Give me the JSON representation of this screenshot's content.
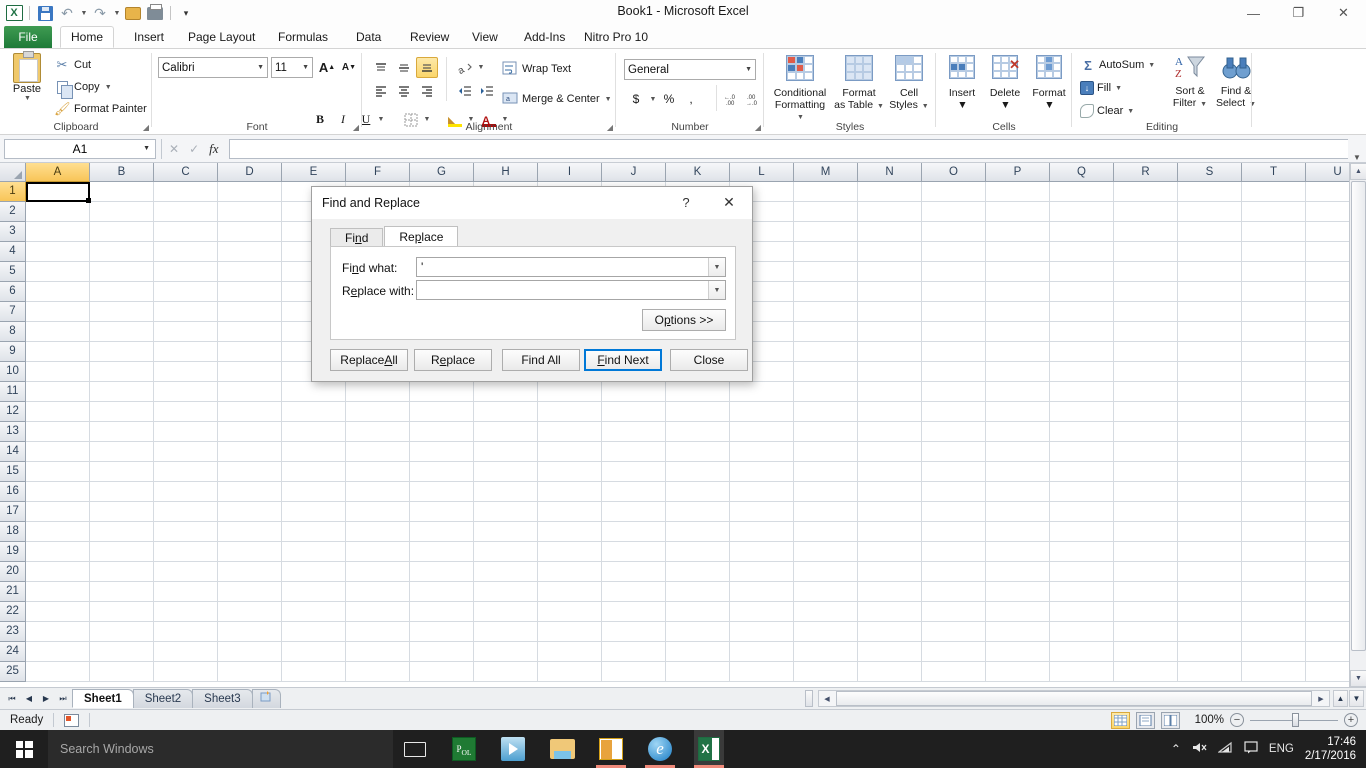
{
  "window": {
    "title": "Book1  -  Microsoft Excel",
    "quick_access": [
      "excel-logo",
      "save",
      "undo",
      "redo",
      "open",
      "print",
      "customize"
    ],
    "controls": {
      "minimize": "—",
      "restore": "❐",
      "close": "✕"
    }
  },
  "ribbon": {
    "tabs": [
      "File",
      "Home",
      "Insert",
      "Page Layout",
      "Formulas",
      "Data",
      "Review",
      "View",
      "Add-Ins",
      "Nitro Pro 10"
    ],
    "active_tab": "Home",
    "right_controls": {
      "collapse": "⌃",
      "help": "?",
      "minimize": "▁",
      "restore": "❐",
      "close": "✖"
    },
    "groups": {
      "clipboard": {
        "title": "Clipboard",
        "paste": "Paste",
        "cut": "Cut",
        "copy": "Copy",
        "format_painter": "Format Painter"
      },
      "font": {
        "title": "Font",
        "font_name": "Calibri",
        "font_size": "11",
        "grow": "A",
        "shrink": "A",
        "bold": "B",
        "italic": "I",
        "underline": "U",
        "borders": "borders",
        "fill_color": "fill-color",
        "font_color": "font-color"
      },
      "alignment": {
        "title": "Alignment",
        "wrap_text": "Wrap Text",
        "merge_center": "Merge & Center",
        "top_align": "Top Align",
        "middle_align": "Middle Align",
        "bottom_align": "Bottom Align",
        "align_left": "Align Text Left",
        "center": "Center",
        "align_right": "Align Text Right",
        "decrease_indent": "Decrease Indent",
        "increase_indent": "Increase Indent",
        "orientation": "Orientation",
        "selected": "Bottom Align"
      },
      "number": {
        "title": "Number",
        "format": "General",
        "accounting": "$",
        "percent": "%",
        "comma": ",",
        "increase_decimal": ".00",
        "decrease_decimal": ".00"
      },
      "styles": {
        "title": "Styles",
        "conditional_formatting": "Conditional\nFormatting",
        "conditional_formatting_l1": "Conditional",
        "conditional_formatting_l2": "Formatting",
        "format_as_table_l1": "Format",
        "format_as_table_l2": "as Table",
        "cell_styles_l1": "Cell",
        "cell_styles_l2": "Styles"
      },
      "cells": {
        "title": "Cells",
        "insert": "Insert",
        "delete": "Delete",
        "format": "Format"
      },
      "editing": {
        "title": "Editing",
        "autosum": "AutoSum",
        "fill": "Fill",
        "clear": "Clear",
        "sort_filter_l1": "Sort &",
        "sort_filter_l2": "Filter",
        "find_select_l1": "Find &",
        "find_select_l2": "Select"
      }
    }
  },
  "formula_bar": {
    "name_box": "A1",
    "formula": "",
    "fx_label": "fx",
    "cancel": "✕",
    "enter": "✓"
  },
  "grid": {
    "columns": [
      "A",
      "B",
      "C",
      "D",
      "E",
      "F",
      "G",
      "H",
      "I",
      "J",
      "K",
      "L",
      "M",
      "N",
      "O",
      "P",
      "Q",
      "R",
      "S",
      "T",
      "U"
    ],
    "rows": [
      1,
      2,
      3,
      4,
      5,
      6,
      7,
      8,
      9,
      10,
      11,
      12,
      13,
      14,
      15,
      16,
      17,
      18,
      19,
      20,
      21,
      22,
      23,
      24,
      25
    ],
    "selected_cell": "A1",
    "selected_column": "A",
    "selected_row": 1,
    "cell_values": []
  },
  "sheet_tabs": {
    "sheets": [
      "Sheet1",
      "Sheet2",
      "Sheet3"
    ],
    "active": "Sheet1",
    "new_sheet_label": "",
    "nav": {
      "first": "⏮",
      "prev": "◀",
      "next": "▶",
      "last": "⏭"
    }
  },
  "status_bar": {
    "mode": "Ready",
    "macro_record": "record-macro",
    "views": [
      "Normal",
      "Page Layout",
      "Page Break Preview"
    ],
    "active_view": "Normal",
    "zoom": "100%",
    "zoom_out": "−",
    "zoom_in": "+"
  },
  "dialog": {
    "title": "Find and Replace",
    "help_btn": "?",
    "close_btn": "✕",
    "tabs": [
      "Find",
      "Replace"
    ],
    "active_tab": "Replace",
    "fields": [
      {
        "label": "Find what:",
        "label_pre": "Fi",
        "label_acc": "n",
        "label_post": "d what:",
        "value": "'"
      },
      {
        "label": "Replace with:",
        "label_pre": "R",
        "label_acc": "e",
        "label_post": "place with:",
        "value": ""
      }
    ],
    "options_button": "Options >>",
    "options_pre": "O",
    "options_acc": "p",
    "options_post": "tions >>",
    "buttons": [
      {
        "label": "Replace All",
        "pre": "Replace ",
        "acc": "A",
        "post": "ll",
        "default": false
      },
      {
        "label": "Replace",
        "pre": "R",
        "acc": "e",
        "post": "place",
        "default": false
      },
      {
        "label": "Find All",
        "pre": "Find All",
        "acc": "",
        "post": "",
        "default": false
      },
      {
        "label": "Find Next",
        "pre": "",
        "acc": "F",
        "post": "ind Next",
        "default": true
      },
      {
        "label": "Close",
        "pre": "Close",
        "acc": "",
        "post": "",
        "default": false
      }
    ]
  },
  "taskbar": {
    "search_placeholder": "Search Windows",
    "start": "start-button",
    "task_view": "task-view",
    "apps": [
      "PoL",
      "Media Player",
      "File Explorer",
      "Outlook",
      "Internet Explorer",
      "Microsoft Excel"
    ],
    "active_app": "Microsoft Excel",
    "tray": {
      "show_hidden": "⌃",
      "volume": "muted",
      "network": "wifi",
      "action_center": "notifications",
      "language": "ENG"
    },
    "time": "17:46",
    "date": "2/17/2016"
  }
}
